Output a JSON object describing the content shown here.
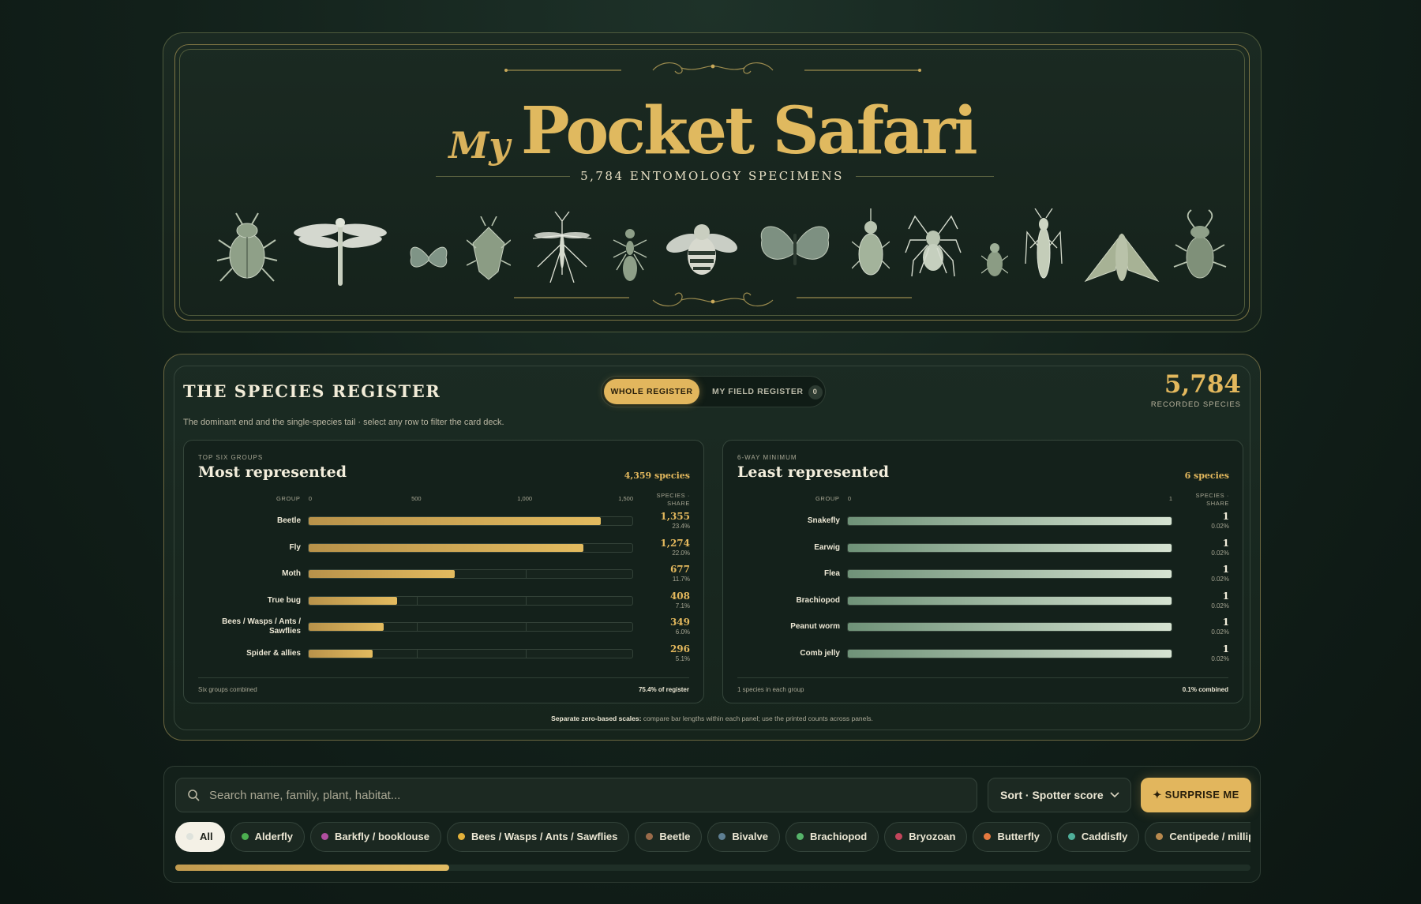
{
  "hero": {
    "title_prefix": "My",
    "title": "Pocket Safari",
    "subtitle": "5,784 ENTOMOLOGY SPECIMENS",
    "illustrations": [
      "scarab-beetle",
      "dragonfly",
      "small-butterfly",
      "shield-bug",
      "mosquito",
      "ant",
      "bee",
      "butterfly",
      "weevil",
      "spider",
      "small-beetle",
      "grasshopper",
      "moth",
      "stag-beetle"
    ]
  },
  "register": {
    "title": "THE SPECIES REGISTER",
    "description": "The dominant end and the single-species tail · select any row to filter the card deck.",
    "toggle": {
      "whole": "WHOLE REGISTER",
      "field": "MY FIELD REGISTER",
      "field_count": "0"
    },
    "total_number": "5,784",
    "total_label": "RECORDED SPECIES",
    "note_bold": "Separate zero-based scales:",
    "note": " compare bar lengths within each panel; use the printed counts across panels."
  },
  "chart_data": [
    {
      "type": "bar",
      "kicker": "TOP SIX GROUPS",
      "title": "Most represented",
      "total": "4,359 species",
      "group_header": "GROUP",
      "value_header": "SPECIES · SHARE",
      "xlim": [
        0,
        1500
      ],
      "ticks": [
        "0",
        "500",
        "1,000",
        "1,500"
      ],
      "categories": [
        "Beetle",
        "Fly",
        "Moth",
        "True bug",
        "Bees / Wasps / Ants / Sawflies",
        "Spider & allies"
      ],
      "values": [
        1355,
        1274,
        677,
        408,
        349,
        296
      ],
      "value_labels": [
        "1,355",
        "1,274",
        "677",
        "408",
        "349",
        "296"
      ],
      "shares": [
        "23.4%",
        "22.0%",
        "11.7%",
        "7.1%",
        "6.0%",
        "5.1%"
      ],
      "footer_left": "Six groups combined",
      "footer_right": "75.4% of register",
      "color": "#e3b85d"
    },
    {
      "type": "bar",
      "kicker": "6-WAY MINIMUM",
      "title": "Least represented",
      "total": "6 species",
      "group_header": "GROUP",
      "value_header": "SPECIES · SHARE",
      "xlim": [
        0,
        1
      ],
      "ticks": [
        "0",
        "1"
      ],
      "categories": [
        "Snakefly",
        "Earwig",
        "Flea",
        "Brachiopod",
        "Peanut worm",
        "Comb jelly"
      ],
      "values": [
        1,
        1,
        1,
        1,
        1,
        1
      ],
      "value_labels": [
        "1",
        "1",
        "1",
        "1",
        "1",
        "1"
      ],
      "shares": [
        "0.02%",
        "0.02%",
        "0.02%",
        "0.02%",
        "0.02%",
        "0.02%"
      ],
      "footer_left": "1 species in each group",
      "footer_right": "0.1% combined",
      "color": "#b9cfb8"
    }
  ],
  "filters": {
    "search_placeholder": "Search name, family, plant, habitat...",
    "sort_label": "Sort · Spotter score",
    "surprise_label": "✦ SURPRISE ME",
    "chips": [
      {
        "label": "All",
        "color": "#dfe3dc",
        "active": true
      },
      {
        "label": "Alderfly",
        "color": "#4caf50"
      },
      {
        "label": "Barkfly / booklouse",
        "color": "#b04fa0"
      },
      {
        "label": "Bees / Wasps / Ants / Sawflies",
        "color": "#e3b13a"
      },
      {
        "label": "Beetle",
        "color": "#9a6b4a"
      },
      {
        "label": "Bivalve",
        "color": "#5e7f93"
      },
      {
        "label": "Brachiopod",
        "color": "#56b36a"
      },
      {
        "label": "Bryozoan",
        "color": "#c2455b"
      },
      {
        "label": "Butterfly",
        "color": "#e5793f"
      },
      {
        "label": "Caddisfly",
        "color": "#4faf9a"
      },
      {
        "label": "Centipede / millipede",
        "color": "#b8894e"
      }
    ],
    "scroll_position": 0.255
  }
}
